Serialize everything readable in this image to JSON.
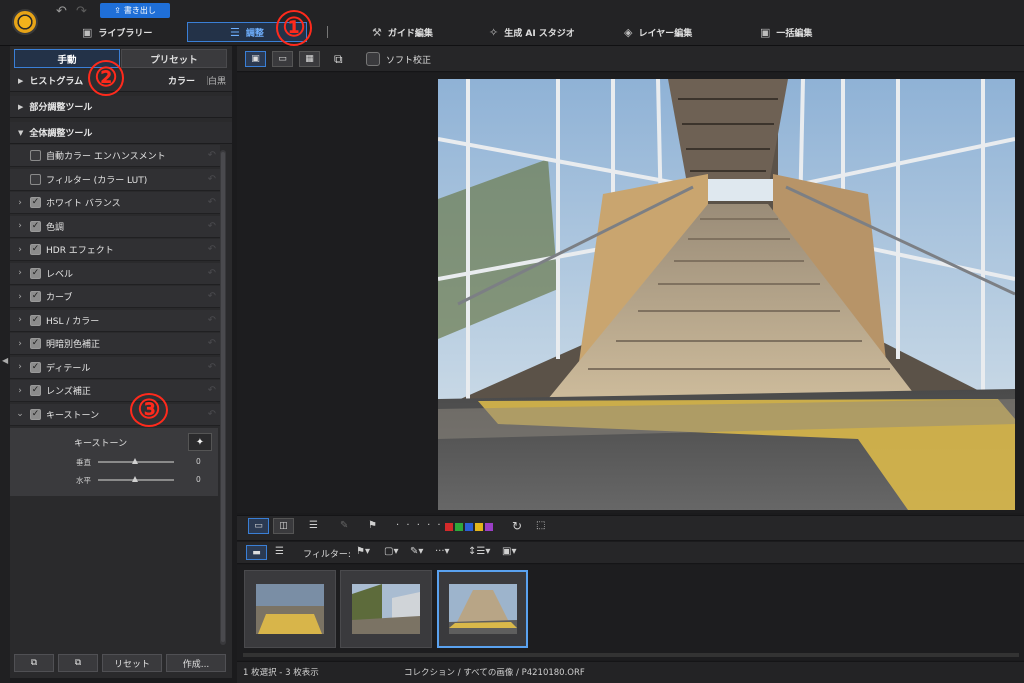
{
  "header": {
    "export_label": "書き出し",
    "tabs": [
      {
        "label": "ライブラリー",
        "icon": "library-icon"
      },
      {
        "label": "調整",
        "icon": "sliders-icon",
        "active": true
      },
      {
        "label": "ガイド編集",
        "icon": "wand-icon"
      },
      {
        "label": "生成 AI スタジオ",
        "icon": "sparkle-icon"
      },
      {
        "label": "レイヤー編集",
        "icon": "layers-icon"
      },
      {
        "label": "一括編集",
        "icon": "batch-icon"
      }
    ],
    "active_color": "#6fb0ff"
  },
  "annotations": [
    "①",
    "②",
    "③"
  ],
  "left_panel": {
    "segments": {
      "manual": "手動",
      "preset": "プリセット"
    },
    "histogram": {
      "label": "ヒストグラム",
      "mode_color": "カラー",
      "mode_mono": "白黒"
    },
    "partial_tools": "部分調整ツール",
    "global_tools": "全体調整ツール",
    "items": [
      {
        "label": "自動カラー エンハンスメント",
        "checked": false,
        "expandable": false
      },
      {
        "label": "フィルター (カラー LUT)",
        "checked": false,
        "expandable": false
      },
      {
        "label": "ホワイト バランス",
        "checked": true,
        "expandable": true
      },
      {
        "label": "色調",
        "checked": true,
        "expandable": true
      },
      {
        "label": "HDR エフェクト",
        "checked": true,
        "expandable": true
      },
      {
        "label": "レベル",
        "checked": true,
        "expandable": true
      },
      {
        "label": "カーブ",
        "checked": true,
        "expandable": true
      },
      {
        "label": "HSL / カラー",
        "checked": true,
        "expandable": true
      },
      {
        "label": "明暗別色補正",
        "checked": true,
        "expandable": true
      },
      {
        "label": "ディテール",
        "checked": true,
        "expandable": true
      },
      {
        "label": "レンズ補正",
        "checked": true,
        "expandable": true
      },
      {
        "label": "キーストーン",
        "checked": true,
        "expandable": true,
        "expanded": true
      }
    ],
    "keystone": {
      "title": "キーストーン",
      "vertical_label": "垂直",
      "vertical_value": "0",
      "horizontal_label": "水平",
      "horizontal_value": "0"
    },
    "bottom": {
      "reset": "リセット",
      "create": "作成..."
    }
  },
  "viewer": {
    "soft_proof_label": "ソフト校正",
    "filter_label": "フィルター:",
    "color_labels": [
      "#d42a2a",
      "#2fa83a",
      "#2c5fd6",
      "#e3b51a",
      "#9b3fc7"
    ]
  },
  "status": {
    "selection": "1 枚選択 - 3 枚表示",
    "path": "コレクション / すべての画像 / P4210180.ORF"
  }
}
